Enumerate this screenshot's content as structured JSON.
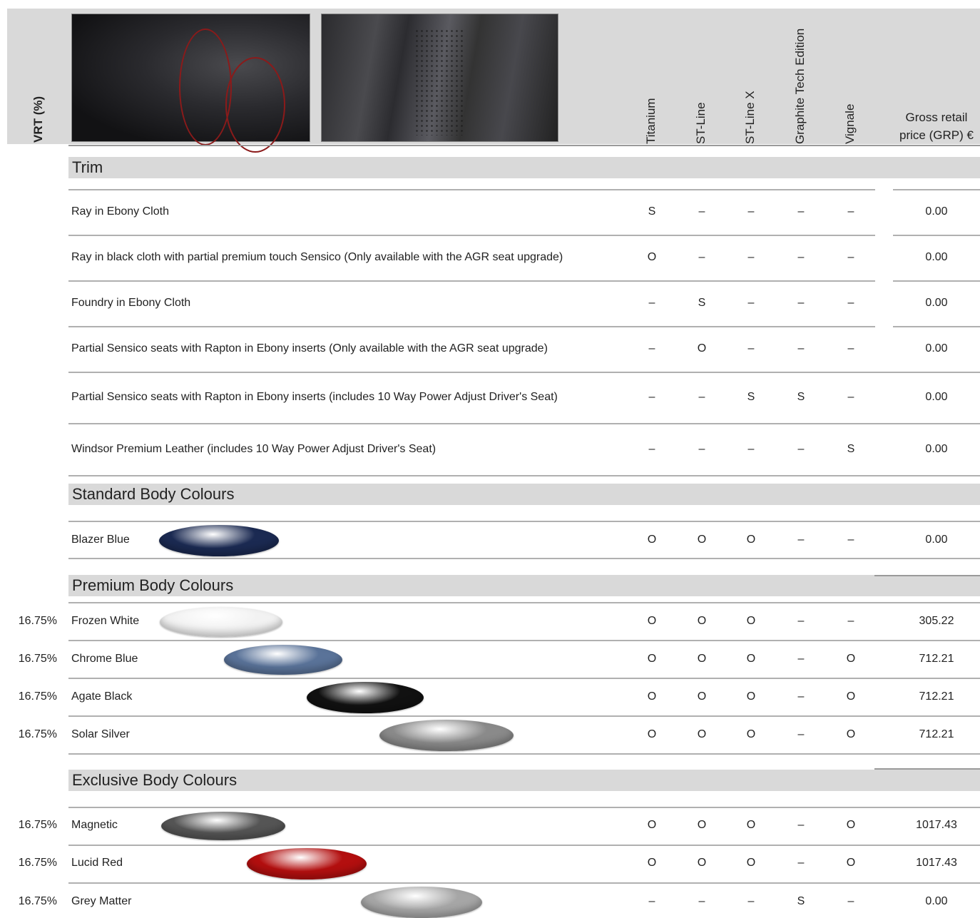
{
  "header": {
    "vrt_label": "VRT (%)",
    "columns": [
      "Titanium",
      "ST-Line",
      "ST-Line X",
      "Graphite Tech Edition",
      "Vignale"
    ],
    "price_label_line1": "Gross retail",
    "price_label_line2": "price (GRP) €",
    "photo1": "interior-seats-photo",
    "photo2": "seat-upholstery-detail-photo"
  },
  "sections": {
    "trim": "Trim",
    "standard": "Standard Body Colours",
    "premium": "Premium Body Colours",
    "exclusive": "Exclusive Body Colours"
  },
  "trim_rows": [
    {
      "label": "Ray in Ebony Cloth",
      "values": [
        "S",
        "–",
        "–",
        "–",
        "–"
      ],
      "price": "0.00"
    },
    {
      "label": "Ray in black cloth with partial premium touch Sensico (Only available with the AGR seat upgrade)",
      "values": [
        "O",
        "–",
        "–",
        "–",
        "–"
      ],
      "price": "0.00"
    },
    {
      "label": "Foundry in Ebony Cloth",
      "values": [
        "–",
        "S",
        "–",
        "–",
        "–"
      ],
      "price": "0.00"
    },
    {
      "label": "Partial Sensico seats with Rapton in Ebony inserts (Only available with the AGR seat upgrade)",
      "values": [
        "–",
        "O",
        "–",
        "–",
        "–"
      ],
      "price": "0.00"
    },
    {
      "label": "Partial Sensico seats with Rapton in Ebony inserts (includes 10 Way Power Adjust Driver's Seat)",
      "values": [
        "–",
        "–",
        "S",
        "S",
        "–"
      ],
      "price": "0.00"
    },
    {
      "label": "Windsor Premium Leather  (includes 10 Way Power Adjust Driver's Seat)",
      "values": [
        "–",
        "–",
        "–",
        "–",
        "S"
      ],
      "price": "0.00"
    }
  ],
  "standard_rows": [
    {
      "label": "Blazer Blue",
      "vrt": "",
      "values": [
        "O",
        "O",
        "O",
        "–",
        "–"
      ],
      "price": "0.00",
      "swatch_color": "#1b2a52"
    }
  ],
  "premium_rows": [
    {
      "label": "Frozen White",
      "vrt": "16.75%",
      "values": [
        "O",
        "O",
        "O",
        "–",
        "–"
      ],
      "price": "305.22",
      "swatch_color": "#f2f2f2"
    },
    {
      "label": "Chrome Blue",
      "vrt": "16.75%",
      "values": [
        "O",
        "O",
        "O",
        "–",
        "O"
      ],
      "price": "712.21",
      "swatch_color": "#5a7399"
    },
    {
      "label": "Agate Black",
      "vrt": "16.75%",
      "values": [
        "O",
        "O",
        "O",
        "–",
        "O"
      ],
      "price": "712.21",
      "swatch_color": "#111111"
    },
    {
      "label": "Solar Silver",
      "vrt": "16.75%",
      "values": [
        "O",
        "O",
        "O",
        "–",
        "O"
      ],
      "price": "712.21",
      "swatch_color": "#8a8a8a"
    }
  ],
  "exclusive_rows": [
    {
      "label": "Magnetic",
      "vrt": "16.75%",
      "values": [
        "O",
        "O",
        "O",
        "–",
        "O"
      ],
      "price": "1017.43",
      "swatch_color": "#555555"
    },
    {
      "label": "Lucid Red",
      "vrt": "16.75%",
      "values": [
        "O",
        "O",
        "O",
        "–",
        "O"
      ],
      "price": "1017.43",
      "swatch_color": "#b30f0f"
    },
    {
      "label": "Grey Matter",
      "vrt": "16.75%",
      "values": [
        "–",
        "–",
        "–",
        "S",
        "–"
      ],
      "price": "0.00",
      "swatch_color": "#a6a6a6"
    }
  ]
}
